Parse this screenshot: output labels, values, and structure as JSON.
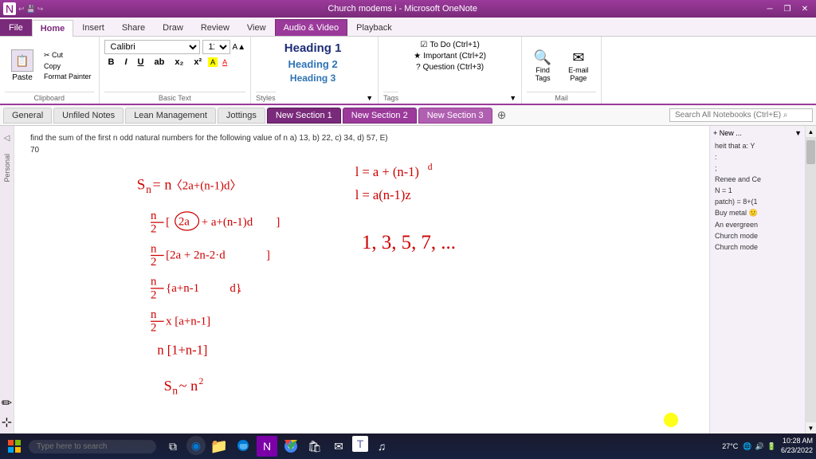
{
  "titlebar": {
    "title": "Church modems i - Microsoft OneNote",
    "minimize_label": "─",
    "restore_label": "❐",
    "close_label": "✕"
  },
  "ribbon": {
    "tabs": [
      {
        "id": "file",
        "label": "File"
      },
      {
        "id": "home",
        "label": "Home",
        "active": true
      },
      {
        "id": "insert",
        "label": "Insert"
      },
      {
        "id": "share",
        "label": "Share"
      },
      {
        "id": "draw",
        "label": "Draw"
      },
      {
        "id": "review",
        "label": "Review"
      },
      {
        "id": "view",
        "label": "View"
      },
      {
        "id": "audiovideo",
        "label": "Audio & Video",
        "special": true
      },
      {
        "id": "playback",
        "label": "Playback"
      }
    ],
    "clipboard": {
      "paste": "Paste",
      "cut": "✂ Cut",
      "copy": "Copy",
      "format_painter": "Format Painter",
      "group_label": "Clipboard"
    },
    "font": {
      "name": "Calibri",
      "size": "11",
      "bold": "B",
      "italic": "I",
      "underline": "U",
      "strikethrough": "ab",
      "subscript": "x₂",
      "superscript": "x²",
      "group_label": "Basic Text"
    },
    "styles": {
      "h1": "Heading 1",
      "h2": "Heading 2",
      "h3": "Heading 3",
      "group_label": "Styles"
    },
    "tags": {
      "items": [
        "☑ To Do (Ctrl+1)",
        "★ Important (Ctrl+2)",
        "? Question (Ctrl+3)"
      ],
      "group_label": "Tags"
    },
    "find_tags": "Find\nTags",
    "email_page": "E-mail\nPage",
    "tools_label": "Mail"
  },
  "nav": {
    "tabs": [
      {
        "id": "general",
        "label": "General"
      },
      {
        "id": "unfiled",
        "label": "Unfiled Notes"
      },
      {
        "id": "lean",
        "label": "Lean Management"
      },
      {
        "id": "jottings",
        "label": "Jottings"
      },
      {
        "id": "newsection1",
        "label": "New Section 1",
        "active": true
      },
      {
        "id": "newsection2",
        "label": "New Section 2"
      },
      {
        "id": "newsection3",
        "label": "New Section 3"
      }
    ],
    "search_placeholder": "Search All Notebooks (Ctrl+E) ⌕"
  },
  "note": {
    "text": "find the sum of the first n odd natural numbers for the following value of n a) 13, b) 22, c) 34, d) 57, E)",
    "number": "70"
  },
  "right_sidebar": {
    "header": "+ New ...",
    "items": [
      "heit that a: Y",
      ":",
      ";",
      "Renee and Ce",
      "N = 1",
      "patch) = 8+(1",
      "Buy metal 🙂",
      "An evergreen",
      "Church mode",
      "Church mode"
    ]
  },
  "taskbar": {
    "search_placeholder": "Type here to search",
    "time": "10:28 AM",
    "date": "6/23/2022",
    "temperature": "27°C",
    "icons": [
      {
        "name": "taskview-icon",
        "symbol": "⧉"
      },
      {
        "name": "cortana-icon",
        "symbol": "◎"
      },
      {
        "name": "search-icon",
        "symbol": "⌕"
      },
      {
        "name": "edge-icon",
        "symbol": "e"
      },
      {
        "name": "explorer-icon",
        "symbol": "📁"
      },
      {
        "name": "onenote-icon",
        "symbol": "N"
      },
      {
        "name": "chrome-icon",
        "symbol": "⊕"
      },
      {
        "name": "store-icon",
        "symbol": "🛍"
      },
      {
        "name": "mail-icon",
        "symbol": "✉"
      },
      {
        "name": "teams-icon",
        "symbol": "T"
      },
      {
        "name": "spotify-icon",
        "symbol": "♫"
      }
    ]
  }
}
